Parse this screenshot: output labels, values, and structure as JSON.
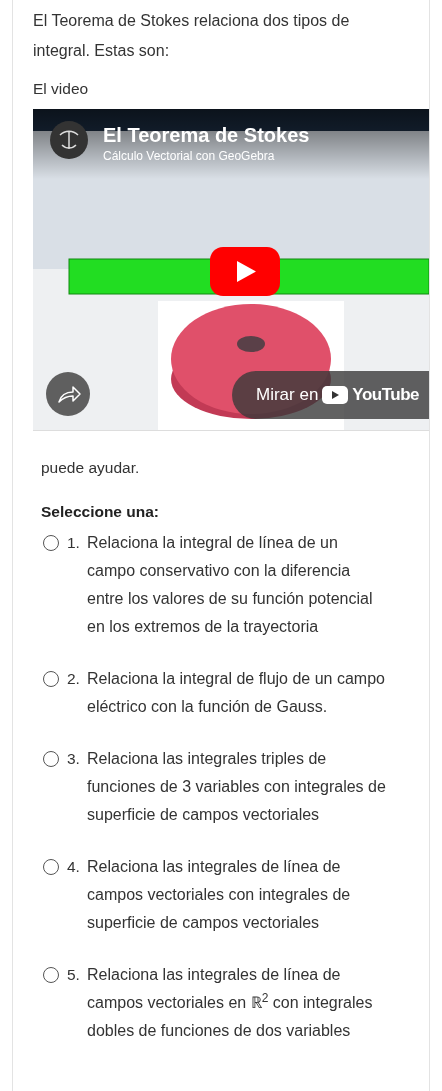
{
  "intro": "El Teorema de Stokes relaciona dos tipos de integral. Estas son:",
  "video_label": "El video",
  "video": {
    "title": "El Teorema de Stokes",
    "channel": "Cálculo Vectorial con GeoGebra",
    "watch_label": "Mirar en",
    "watch_brand": "YouTube"
  },
  "after": "puede ayudar.",
  "prompt": "Seleccione una:",
  "options": [
    {
      "number": "1.",
      "text": "Relaciona la integral de línea de un campo conservativo con la diferencia entre los valores de su función potencial en los extremos de la trayectoria",
      "selected": false
    },
    {
      "number": "2.",
      "text": "Relaciona la integral de flujo de un campo eléctrico con la función de Gauss.",
      "selected": false
    },
    {
      "number": "3.",
      "text": "Relaciona las integrales triples de funciones de 3 variables con integrales de superficie de campos vectoriales",
      "selected": false
    },
    {
      "number": "4.",
      "text": "Relaciona las integrales de línea de campos vectoriales con integrales de superficie de campos vectoriales",
      "selected": false
    },
    {
      "number": "5.",
      "text": "Relaciona las integrales de línea de campos vectoriales en ℝ$^{2}$ con integrales dobles de funciones de dos variables",
      "selected": false
    }
  ]
}
